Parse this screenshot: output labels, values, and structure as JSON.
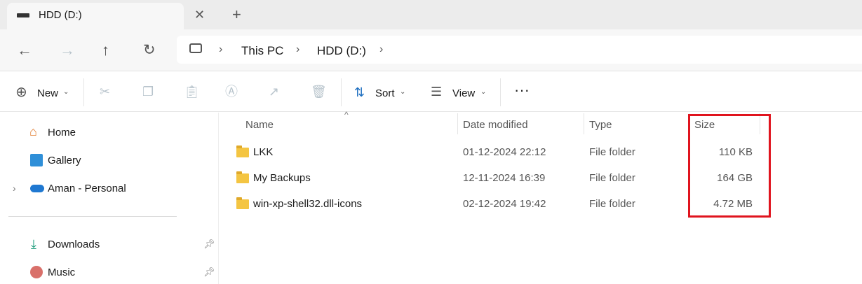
{
  "tab": {
    "title": "HDD (D:)"
  },
  "breadcrumb": [
    "This PC",
    "HDD (D:)"
  ],
  "toolbar": {
    "new": "New",
    "sort": "Sort",
    "view": "View"
  },
  "sidebar": {
    "items": [
      {
        "label": "Home"
      },
      {
        "label": "Gallery"
      },
      {
        "label": "Aman - Personal"
      },
      {
        "label": "Downloads"
      },
      {
        "label": "Music"
      }
    ]
  },
  "columns": {
    "name": "Name",
    "date": "Date modified",
    "type": "Type",
    "size": "Size"
  },
  "files": [
    {
      "name": "LKK",
      "date": "01-12-2024 22:12",
      "type": "File folder",
      "size": "110 KB"
    },
    {
      "name": "My Backups",
      "date": "12-11-2024 16:39",
      "type": "File folder",
      "size": "164 GB"
    },
    {
      "name": "win-xp-shell32.dll-icons",
      "date": "02-12-2024 19:42",
      "type": "File folder",
      "size": "4.72 MB"
    }
  ],
  "colors": {
    "highlight": "#e0141e",
    "folder": "#f4c542"
  }
}
